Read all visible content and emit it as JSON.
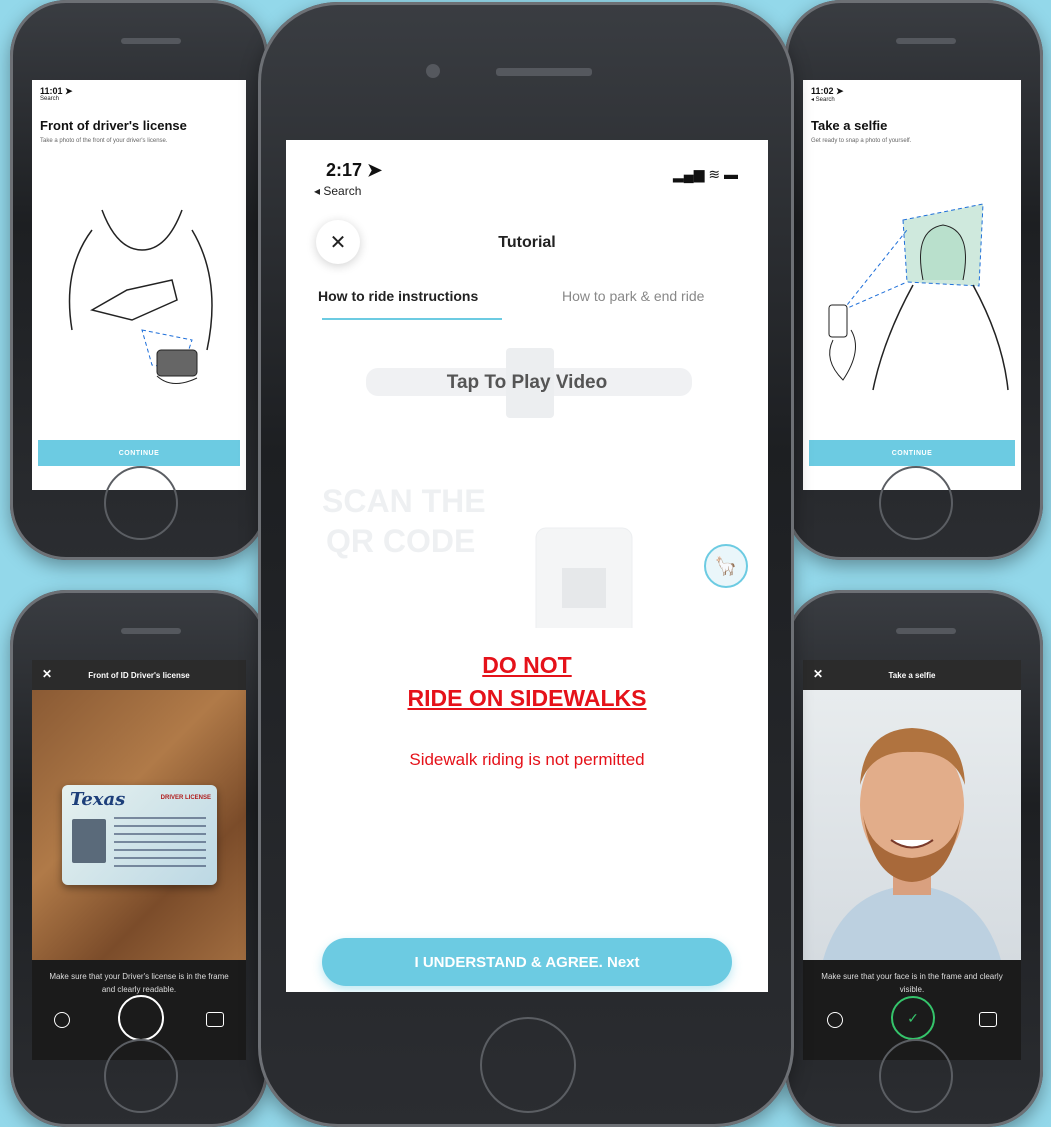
{
  "top_left": {
    "time": "11:01 ➤",
    "back": "Search",
    "title": "Front of driver's license",
    "subtitle": "Take a photo of the front of your driver's license.",
    "button": "CONTINUE"
  },
  "top_right": {
    "time": "11:02 ➤",
    "back": "◂ Search",
    "title": "Take a selfie",
    "subtitle": "Get ready to snap a photo of yourself.",
    "button": "CONTINUE"
  },
  "bottom_left": {
    "header": "Front of ID Driver's license",
    "close": "✕",
    "card_state": "Texas",
    "card_type": "DRIVER LICENSE",
    "message": "Make sure that your Driver's license is in the frame and clearly readable."
  },
  "bottom_right": {
    "header": "Take a selfie",
    "close": "✕",
    "message": "Make sure that your face is in the frame and clearly visible."
  },
  "main": {
    "time": "2:17 ➤",
    "back": "◂ Search",
    "status_icons": "▂▄▆ ≋ ▬",
    "close": "✕",
    "title": "Tutorial",
    "tabs": [
      "How to ride instructions",
      "How to park & end ride"
    ],
    "video_label": "Tap To Play Video",
    "watermark_line1": "SCAN THE",
    "watermark_line2": "QR CODE",
    "warning_line1": "DO NOT",
    "warning_line2": "RIDE ON SIDEWALKS",
    "warning_sub": "Sidewalk riding is not permitted",
    "agree_button": "I UNDERSTAND & AGREE. Next"
  },
  "colors": {
    "background": "#93d8ea",
    "accent": "#6ccbe2",
    "warning": "#e5121a"
  }
}
